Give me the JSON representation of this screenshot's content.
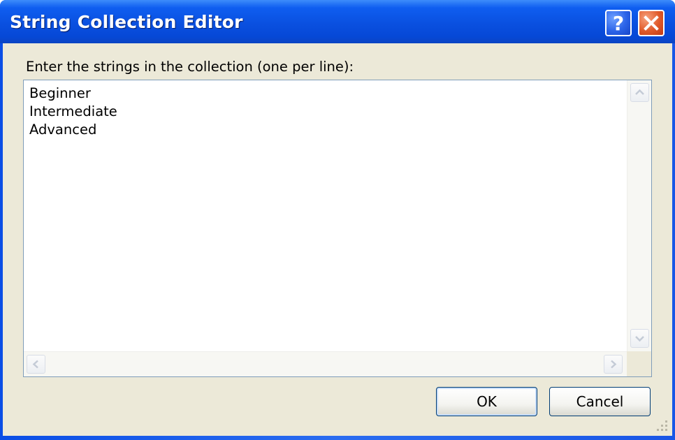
{
  "window": {
    "title": "String Collection Editor",
    "help_glyph": "?",
    "close_icon": "close-x-icon"
  },
  "editor": {
    "prompt_label": "Enter the strings in the collection (one per line):",
    "lines": [
      "Beginner",
      "Intermediate",
      "Advanced"
    ]
  },
  "buttons": {
    "ok_label": "OK",
    "cancel_label": "Cancel"
  },
  "colors": {
    "titlebar": "#0a50e0",
    "dialog_face": "#ece9d8",
    "close_button": "#e05a2a"
  }
}
